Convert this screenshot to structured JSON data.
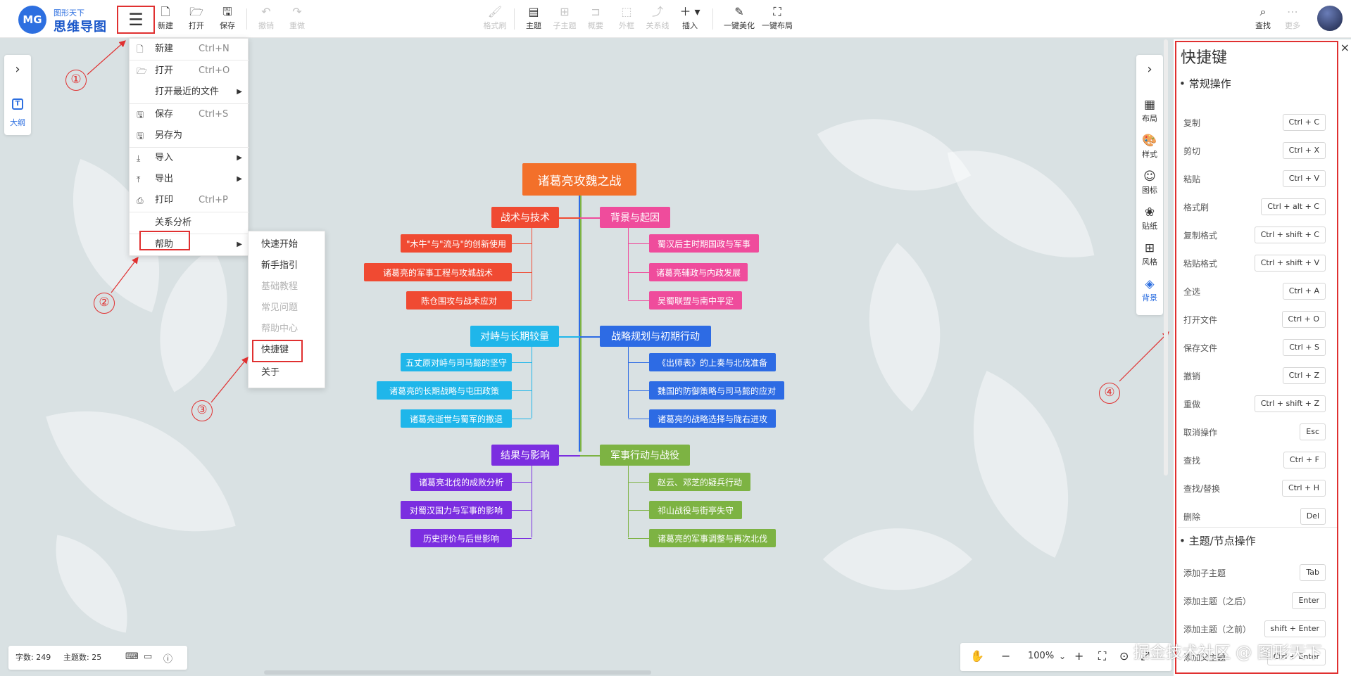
{
  "app": {
    "logo_mark": "MG",
    "logo_subtitle": "图形天下",
    "logo_title": "思维导图"
  },
  "toolbar": {
    "new": "新建",
    "open": "打开",
    "save": "保存",
    "undo": "撤销",
    "redo": "重做",
    "format_brush": "格式刷",
    "topic": "主题",
    "subtopic": "子主题",
    "summary": "概要",
    "boundary": "外框",
    "relation": "关系线",
    "insert": "插入",
    "beautify": "一键美化",
    "layout": "一键布局",
    "search": "查找",
    "more": "更多"
  },
  "main_menu": {
    "items": [
      {
        "label": "新建",
        "shortcut": "Ctrl+N",
        "icon": "file-icon"
      },
      {
        "label": "打开",
        "shortcut": "Ctrl+O",
        "icon": "folder-icon"
      },
      {
        "label": "打开最近的文件",
        "shortcut": "",
        "icon": ""
      },
      {
        "label": "保存",
        "shortcut": "Ctrl+S",
        "icon": "save-icon"
      },
      {
        "label": "另存为",
        "shortcut": "",
        "icon": "save-as-icon"
      },
      {
        "label": "导入",
        "shortcut": "",
        "icon": "import-icon"
      },
      {
        "label": "导出",
        "shortcut": "",
        "icon": "export-icon"
      },
      {
        "label": "打印",
        "shortcut": "Ctrl+P",
        "icon": "print-icon"
      },
      {
        "label": "关系分析",
        "shortcut": "",
        "icon": ""
      },
      {
        "label": "帮助",
        "shortcut": "",
        "icon": ""
      }
    ]
  },
  "help_submenu": {
    "items": [
      {
        "label": "快速开始",
        "disabled": false
      },
      {
        "label": "新手指引",
        "disabled": false
      },
      {
        "label": "基础教程",
        "disabled": true
      },
      {
        "label": "常见问题",
        "disabled": true
      },
      {
        "label": "帮助中心",
        "disabled": true
      },
      {
        "label": "快捷键",
        "disabled": false
      },
      {
        "label": "关于",
        "disabled": false
      }
    ]
  },
  "left_panel": {
    "outline_label": "大纲"
  },
  "right_tools": {
    "items": [
      "布局",
      "样式",
      "图标",
      "贴纸",
      "风格",
      "背景"
    ],
    "active": "背景"
  },
  "mindmap": {
    "root": "诸葛亮攻魏之战",
    "branches": [
      {
        "title": "战术与技术",
        "color": "#f04a32",
        "children": [
          "\"木牛\"与\"流马\"的创新使用",
          "诸葛亮的军事工程与攻城战术",
          "陈仓围攻与战术应对"
        ]
      },
      {
        "title": "背景与起因",
        "color": "#ef4c9c",
        "children": [
          "蜀汉后主时期国政与军事",
          "诸葛亮辅政与内政发展",
          "吴蜀联盟与南中平定"
        ]
      },
      {
        "title": "对峙与长期较量",
        "color": "#1fb6ea",
        "children": [
          "五丈原对峙与司马懿的坚守",
          "诸葛亮的长期战略与屯田政策",
          "诸葛亮逝世与蜀军的撤退"
        ]
      },
      {
        "title": "战略规划与初期行动",
        "color": "#2d6be4",
        "children": [
          "《出师表》的上奏与北伐准备",
          "魏国的防御策略与司马懿的应对",
          "诸葛亮的战略选择与陇右进攻"
        ]
      },
      {
        "title": "结果与影响",
        "color": "#7b2ee0",
        "children": [
          "诸葛亮北伐的成败分析",
          "对蜀汉国力与军事的影响",
          "历史评价与后世影响"
        ]
      },
      {
        "title": "军事行动与战役",
        "color": "#7db343",
        "children": [
          "赵云、邓芝的疑兵行动",
          "祁山战役与街亭失守",
          "诸葛亮的军事调整与再次北伐"
        ]
      }
    ],
    "root_color": "#f3702a"
  },
  "annotations": [
    "①",
    "②",
    "③",
    "④"
  ],
  "shortcuts": {
    "title": "快捷键",
    "close": "×",
    "sections": [
      {
        "title": "• 常规操作",
        "rows": [
          {
            "name": "复制",
            "key": "Ctrl + C"
          },
          {
            "name": "剪切",
            "key": "Ctrl + X"
          },
          {
            "name": "粘贴",
            "key": "Ctrl + V"
          },
          {
            "name": "格式刷",
            "key": "Ctrl + alt + C"
          },
          {
            "name": "复制格式",
            "key": "Ctrl + shift + C"
          },
          {
            "name": "粘贴格式",
            "key": "Ctrl + shift + V"
          },
          {
            "name": "全选",
            "key": "Ctrl + A"
          },
          {
            "name": "打开文件",
            "key": "Ctrl + O"
          },
          {
            "name": "保存文件",
            "key": "Ctrl + S"
          },
          {
            "name": "撤销",
            "key": "Ctrl + Z"
          },
          {
            "name": "重做",
            "key": "Ctrl + shift + Z"
          },
          {
            "name": "取消操作",
            "key": "Esc"
          },
          {
            "name": "查找",
            "key": "Ctrl + F"
          },
          {
            "name": "查找/替换",
            "key": "Ctrl + H"
          },
          {
            "name": "删除",
            "key": "Del"
          }
        ]
      },
      {
        "title": "• 主题/节点操作",
        "rows": [
          {
            "name": "添加子主题",
            "key": "Tab"
          },
          {
            "name": "添加主题（之后）",
            "key": "Enter"
          },
          {
            "name": "添加主题（之前）",
            "key": "shift + Enter"
          },
          {
            "name": "添加父主题",
            "key": "Ctrl + Enter"
          }
        ]
      }
    ]
  },
  "status": {
    "char_count": "字数: 249",
    "topic_count": "主题数: 25"
  },
  "zoom": {
    "level": "100%"
  },
  "watermark": "掘金技术社区 @ 图形天下"
}
